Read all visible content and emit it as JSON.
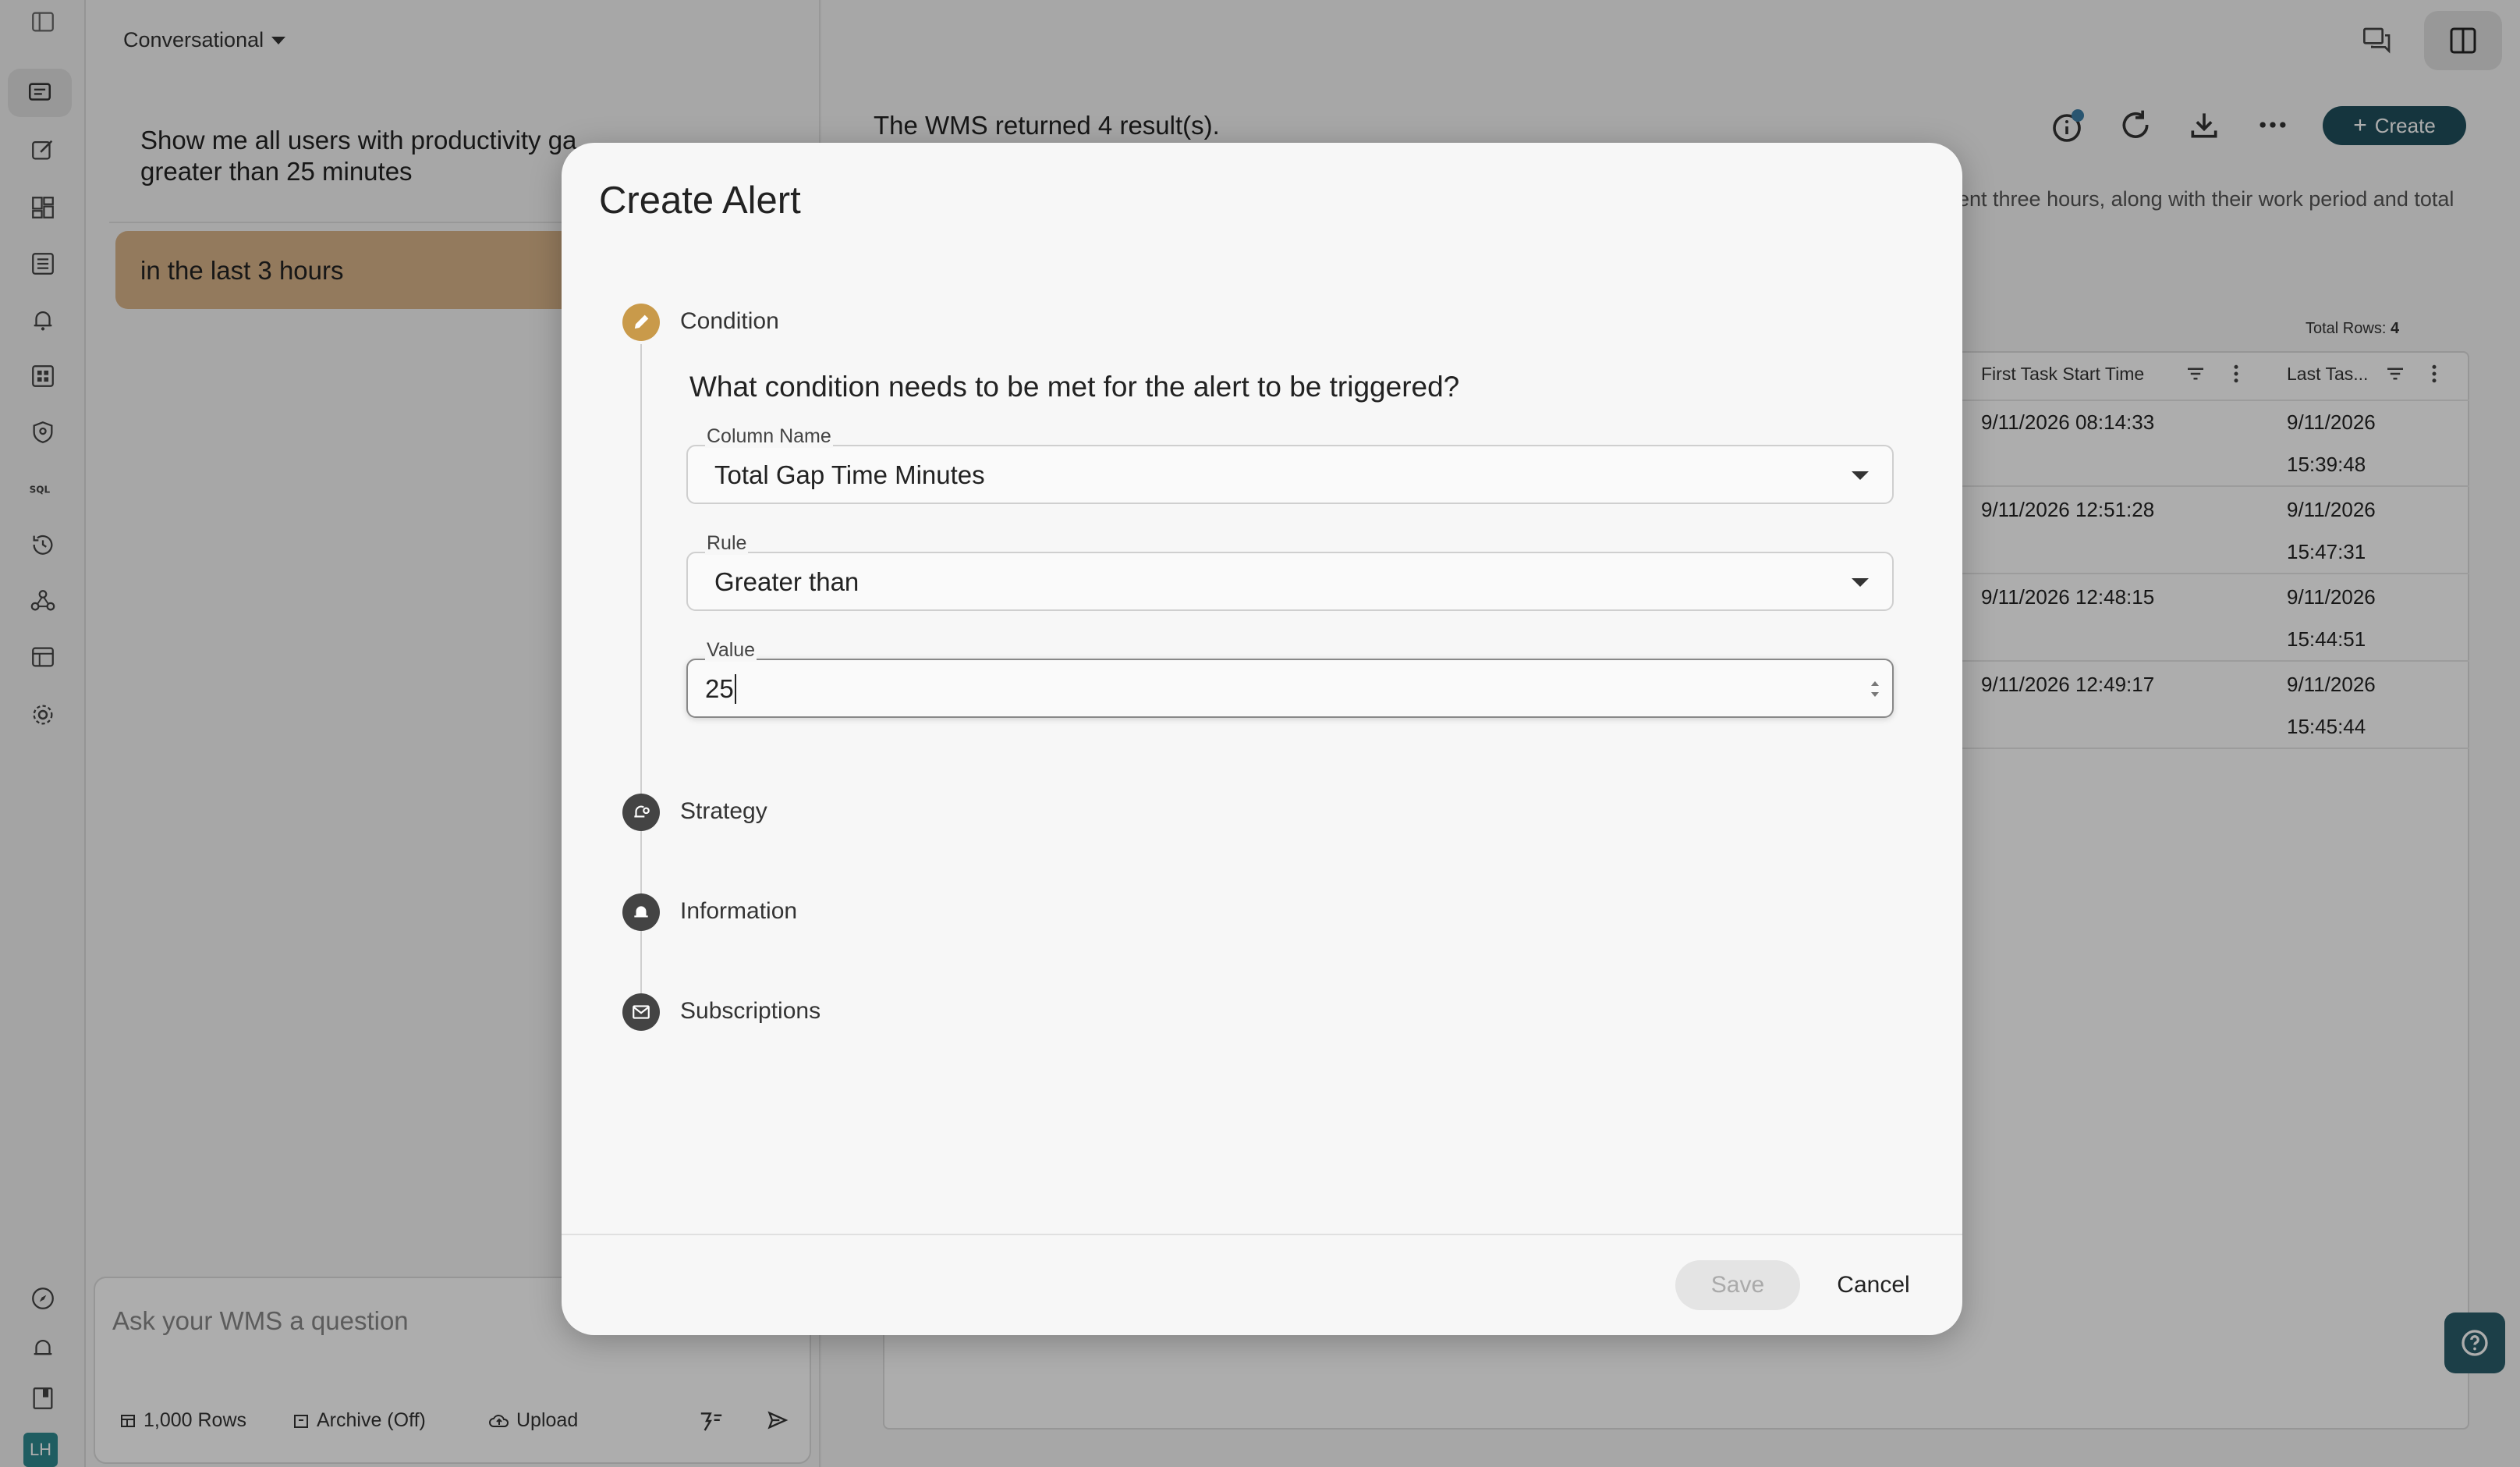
{
  "chat": {
    "mode_label": "Conversational",
    "user_message": "Show me all users with productivity gap time greater than 25 minutes",
    "user_message_visible_line1": "Show me all users with productivity ga",
    "user_message_visible_line2": "greater than 25 minutes",
    "reply_message": "in the last 3 hours",
    "composer_placeholder": "Ask your WMS a question",
    "rows_label": "1,000 Rows",
    "archive_label": "Archive (Off)",
    "upload_label": "Upload",
    "avatar_initials": "LH"
  },
  "main": {
    "result_text": "The WMS returned 4 result(s).",
    "description_fragment": "ent three hours, along with their work period and total",
    "create_label": "Create",
    "total_rows_label": "Total Rows:",
    "total_rows_value": "4",
    "columns": [
      "First Task Start Time",
      "Last Tas..."
    ],
    "rows": [
      {
        "first": "9/11/2026 08:14:33",
        "last_date": "9/11/2026",
        "last_time": "15:39:48"
      },
      {
        "first": "9/11/2026 12:51:28",
        "last_date": "9/11/2026",
        "last_time": "15:47:31"
      },
      {
        "first": "9/11/2026 12:48:15",
        "last_date": "9/11/2026",
        "last_time": "15:44:51"
      },
      {
        "first": "9/11/2026 12:49:17",
        "last_date": "9/11/2026",
        "last_time": "15:45:44"
      }
    ]
  },
  "modal": {
    "title": "Create Alert",
    "steps": {
      "condition": "Condition",
      "strategy": "Strategy",
      "information": "Information",
      "subscriptions": "Subscriptions"
    },
    "question": "What condition needs to be met for the alert to be triggered?",
    "column_name_label": "Column Name",
    "column_name_value": "Total Gap Time Minutes",
    "rule_label": "Rule",
    "rule_value": "Greater than",
    "value_label": "Value",
    "value_value": "25",
    "save_label": "Save",
    "cancel_label": "Cancel"
  },
  "colors": {
    "accent_step": "#c99a4a",
    "primary_button": "#1f4f5c",
    "reply_bubble": "#d9b48a"
  }
}
